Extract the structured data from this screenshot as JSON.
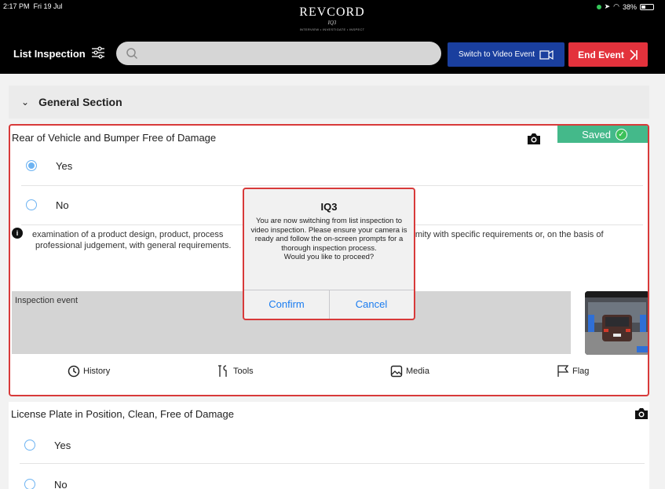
{
  "status_bar": {
    "time": "2:17 PM",
    "date": "Fri 19 Jul",
    "battery": "38%"
  },
  "logo": {
    "main": "REVCORD",
    "sub": "IQ3",
    "tagline": "INTERVIEW • INVESTIGATE • INSPECT"
  },
  "header": {
    "title": "List Inspection",
    "search_placeholder": "",
    "switch_button": "Switch to Video Event",
    "end_button": "End Event"
  },
  "section": {
    "title": "General Section"
  },
  "card1": {
    "question": "Rear of Vehicle and Bumper Free of Damage",
    "saved_label": "Saved",
    "options": [
      "Yes",
      "No"
    ],
    "selected": "Yes",
    "info_left_line1": "examination of a product design, product, process",
    "info_left_line2": "professional judgement, with general requirements.",
    "info_right": "formity with specific requirements or, on the basis of",
    "event_label": "Inspection event",
    "actions": {
      "history": "History",
      "tools": "Tools",
      "media": "Media",
      "flag": "Flag"
    }
  },
  "card2": {
    "question": "License Plate in Position, Clean, Free of Damage",
    "options": [
      "Yes",
      "No"
    ]
  },
  "dialog": {
    "title": "IQ3",
    "message": "You are now switching from list inspection to video inspection. Please ensure your camera is ready and follow the on-screen prompts for a thorough inspection process.",
    "question": "Would you like to proceed?",
    "confirm": "Confirm",
    "cancel": "Cancel"
  },
  "colors": {
    "accent_blue": "#1a3f9e",
    "accent_red": "#e3323c",
    "saved_green": "#44b98a",
    "radio_blue": "#6db3f2"
  }
}
